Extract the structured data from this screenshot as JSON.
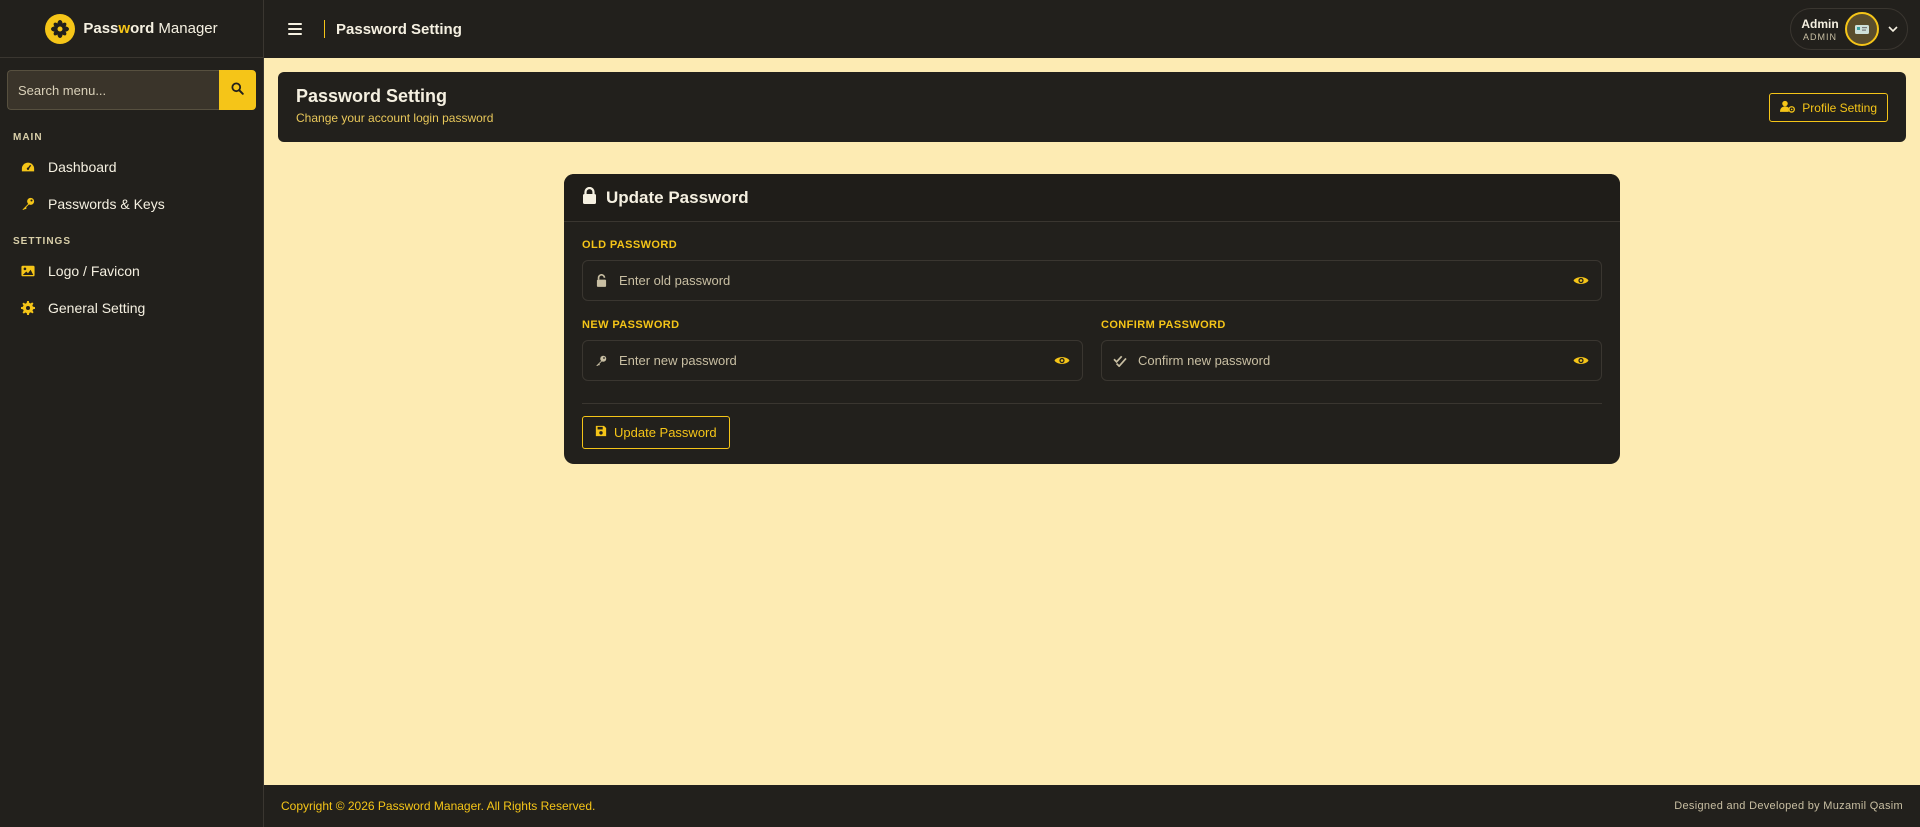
{
  "brand": {
    "name_part1": "Pass",
    "name_highlight": "w",
    "name_part2": "ord",
    "name_part3": "Manager"
  },
  "sidebar": {
    "search_placeholder": "Search menu...",
    "sections": [
      {
        "label": "MAIN"
      },
      {
        "label": "SETTINGS"
      }
    ],
    "items": [
      {
        "label": "Dashboard",
        "icon": "dashboard-icon"
      },
      {
        "label": "Passwords & Keys",
        "icon": "key-icon"
      },
      {
        "label": "Logo / Favicon",
        "icon": "image-icon"
      },
      {
        "label": "General Setting",
        "icon": "gear-icon"
      }
    ]
  },
  "topbar": {
    "title": "Password Setting",
    "user_name": "Admin",
    "user_role": "ADMIN"
  },
  "page_header": {
    "title": "Password Setting",
    "subtitle": "Change your account login password",
    "profile_button": "Profile Setting"
  },
  "form": {
    "title": "Update Password",
    "old_label": "OLD PASSWORD",
    "old_placeholder": "Enter old password",
    "new_label": "NEW PASSWORD",
    "new_placeholder": "Enter new password",
    "confirm_label": "CONFIRM PASSWORD",
    "confirm_placeholder": "Confirm new password",
    "submit_label": "Update Password"
  },
  "footer": {
    "copyright": "Copyright © 2026 Password Manager. All Rights Reserved.",
    "credit": "Designed and Developed by Muzamil Qasim"
  },
  "colors": {
    "accent": "#f5c518",
    "panel": "#22201c",
    "background": "#fdebb3"
  }
}
